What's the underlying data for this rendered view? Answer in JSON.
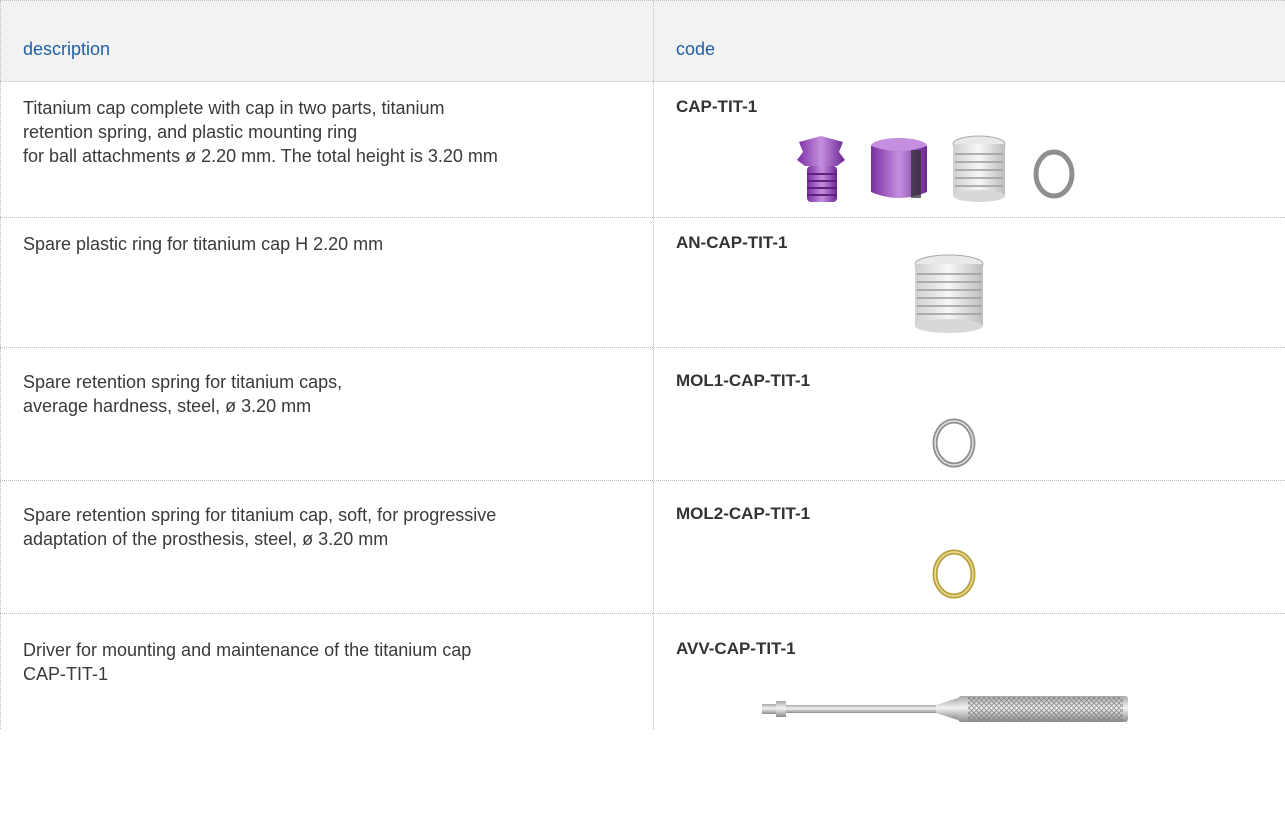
{
  "header": {
    "description": "description",
    "code": "code"
  },
  "rows": [
    {
      "description_lines": [
        "Titanium cap complete with cap in two parts, titanium",
        "retention spring, and plastic mounting ring",
        "for ball attachments ø 2.20 mm. The total height is 3.20 mm"
      ],
      "code": "CAP-TIT-1"
    },
    {
      "description_lines": [
        "Spare plastic ring for titanium cap H 2.20 mm"
      ],
      "code": "AN-CAP-TIT-1"
    },
    {
      "description_lines": [
        "Spare retention spring for titanium caps,",
        "average hardness, steel, ø 3.20 mm"
      ],
      "code": "MOL1-CAP-TIT-1"
    },
    {
      "description_lines": [
        "Spare retention spring for titanium cap, soft, for progressive",
        "adaptation of the prosthesis, steel, ø 3.20 mm"
      ],
      "code": "MOL2-CAP-TIT-1"
    },
    {
      "description_lines": [
        "Driver for mounting and maintenance of the titanium cap",
        "CAP-TIT-1"
      ],
      "code": "AVV-CAP-TIT-1"
    }
  ],
  "colors": {
    "header_text": "#1f5fa8",
    "header_bg": "#f2f2f2",
    "purple": "#8a3fb3",
    "gold": "#c8b04a"
  }
}
